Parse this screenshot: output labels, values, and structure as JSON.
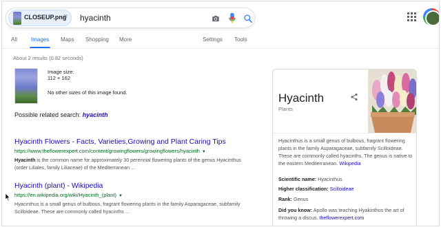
{
  "search": {
    "image_chip_name": "CLOSEUP.png",
    "chip_close": "×",
    "query": "hyacinth"
  },
  "tabs": [
    {
      "label": "All"
    },
    {
      "label": "Images"
    },
    {
      "label": "Maps"
    },
    {
      "label": "Shopping"
    },
    {
      "label": "More"
    },
    {
      "label": "Settings"
    },
    {
      "label": "Tools"
    }
  ],
  "stats": "About 2 results (0.82 seconds)",
  "image_info": {
    "size_label": "Image size:",
    "size_value": "112 × 162",
    "note": "No other sizes of this image found."
  },
  "related": {
    "prefix": "Possible related search:",
    "term": "hyacinth"
  },
  "results": [
    {
      "title": "Hyacinth Flowers - Facts, Varieties,Growing and Plant Caring Tips",
      "url": "https://www.theflowerexpert.com/content/growingflowers/growingflowers/hyacinth",
      "snippet_bold": "Hyacinth",
      "snippet_line1": " is the common name for approximately 30 perennial flowering plants of the genus Hyacinthus",
      "snippet_line2": "(order Liliales, family Liliaceae) of the Mediterranean ..."
    },
    {
      "title": "Hyacinth (plant) - Wikipedia",
      "url": "https://en.wikipedia.org/wiki/Hyacinth_(plant)",
      "snippet_line1": "Hyacinthus is a small genus of bulbous, fragrant flowering plants in the family Asparagaceae, subfamily",
      "snippet_line2": "Scilloideae. These are commonly called hyacinths ..."
    }
  ],
  "knowledge_panel": {
    "title": "Hyacinth",
    "subtitle": "Plants",
    "description": "Hyacinthus is a small genus of bulbous, fragrant flowering plants in the family Asparagaceae, subfamily Scilloideae. These are commonly called hyacinths. The genus is native to the eastern Mediterranean.",
    "description_link": "Wikipedia",
    "facts": [
      {
        "label": "Scientific name:",
        "value": "Hyacinthus",
        "link": false
      },
      {
        "label": "Higher classification:",
        "value": "Scilloideae",
        "link": true
      },
      {
        "label": "Rank:",
        "value": "Genus",
        "link": false
      }
    ],
    "did_you_know_label": "Did you know:",
    "did_you_know_text": "Apollo was teaching Hyakinthos the art of throwing a discus.",
    "did_you_know_link": "theflowerexpert.com"
  },
  "colors": {
    "link": "#1a0dab",
    "url_green": "#006621",
    "accent_blue": "#1a73e8"
  }
}
